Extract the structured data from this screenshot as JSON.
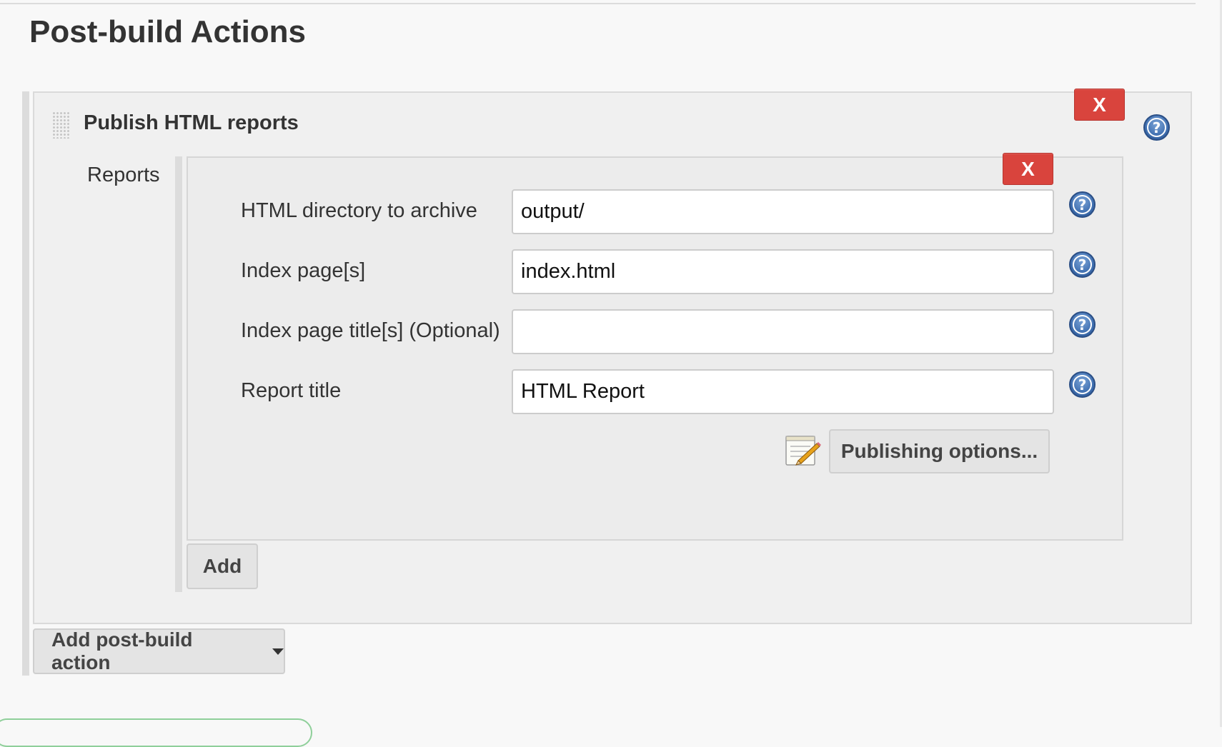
{
  "section": {
    "title": "Post-build Actions"
  },
  "action": {
    "title": "Publish HTML reports",
    "remove_label": "X",
    "help_icon": "help-icon",
    "drag_icon": "drag-handle-icon"
  },
  "reports": {
    "label": "Reports",
    "remove_label": "X",
    "fields": [
      {
        "label": "HTML directory to archive",
        "value": "output/",
        "help_icon": "help-icon"
      },
      {
        "label": "Index page[s]",
        "value": "index.html",
        "help_icon": "help-icon"
      },
      {
        "label": "Index page title[s] (Optional)",
        "value": "",
        "help_icon": "help-icon"
      },
      {
        "label": "Report title",
        "value": "HTML Report",
        "help_icon": "help-icon"
      }
    ],
    "publishing_icon": "notepad-edit-icon",
    "publishing_button": "Publishing options...",
    "add_button": "Add"
  },
  "add_post_build_button": "Add post-build action",
  "colors": {
    "danger": "#d9443d",
    "help_blue": "#3f6fb0",
    "panel_bg": "#f0f0f0",
    "page_bg": "#f8f8f8"
  }
}
